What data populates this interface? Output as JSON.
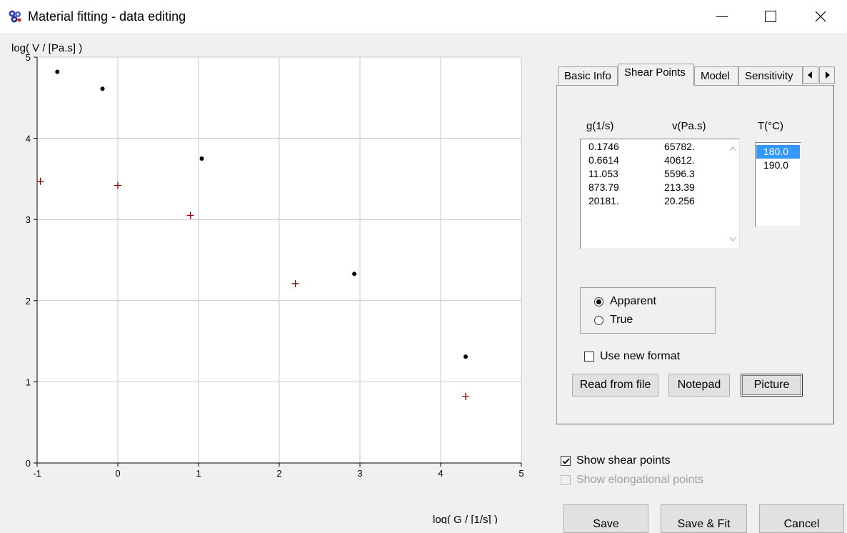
{
  "window": {
    "title": "Material fitting - data editing",
    "app_icon": "gear-cluster-icon"
  },
  "chart_data": {
    "type": "scatter",
    "ylabel": "log( V / [Pa.s] )",
    "xlabel": "log( G / [1/s] )",
    "xlim": [
      -1,
      5
    ],
    "ylim": [
      0,
      5
    ],
    "x_ticks": [
      "-1",
      "0",
      "1",
      "2",
      "3",
      "4",
      "5"
    ],
    "y_ticks": [
      "0",
      "1",
      "2",
      "3",
      "4",
      "5"
    ],
    "grid": true,
    "series": [
      {
        "marker": "dot",
        "color": "#000000",
        "points": [
          [
            -0.75,
            4.82
          ],
          [
            -0.19,
            4.61
          ],
          [
            1.04,
            3.75
          ],
          [
            2.93,
            2.33
          ],
          [
            4.31,
            1.31
          ]
        ]
      },
      {
        "marker": "plus",
        "color": "#8b0000",
        "points": [
          [
            -0.96,
            3.47
          ],
          [
            0.0,
            3.42
          ],
          [
            0.9,
            3.05
          ],
          [
            2.2,
            2.21
          ],
          [
            4.31,
            0.82
          ]
        ]
      }
    ]
  },
  "tabs": {
    "items": [
      {
        "label": "Basic Info",
        "active": false
      },
      {
        "label": "Shear Points",
        "active": true
      },
      {
        "label": "Model",
        "active": false
      },
      {
        "label": "Sensitivity",
        "active": false
      }
    ],
    "scroll_left_icon": "arrow-left-icon",
    "scroll_right_icon": "arrow-right-icon"
  },
  "shear_points": {
    "col_g": "g(1/s)",
    "col_v": "v(Pa.s)",
    "col_t": "T(°C)",
    "rows": [
      {
        "g": "0.1746",
        "v": "65782."
      },
      {
        "g": "0.6614",
        "v": "40612."
      },
      {
        "g": "11.053",
        "v": "5596.3"
      },
      {
        "g": "873.79",
        "v": "213.39"
      },
      {
        "g": "20181.",
        "v": "20.256"
      }
    ],
    "temperatures": [
      {
        "label": "180.0",
        "selected": true
      },
      {
        "label": "190.0",
        "selected": false
      }
    ]
  },
  "viscosity_type": {
    "options": [
      {
        "label": "Apparent",
        "checked": true
      },
      {
        "label": "True",
        "checked": false
      }
    ]
  },
  "use_new_format": {
    "label": "Use new format",
    "checked": false
  },
  "buttons": {
    "read_from_file": "Read from file",
    "notepad": "Notepad",
    "picture": "Picture",
    "save": "Save",
    "save_fit": "Save & Fit",
    "cancel": "Cancel"
  },
  "display_options": {
    "show_shear": {
      "label": "Show shear points",
      "checked": true
    },
    "show_elong": {
      "label": "Show elongational points",
      "checked": false,
      "disabled": true
    }
  }
}
